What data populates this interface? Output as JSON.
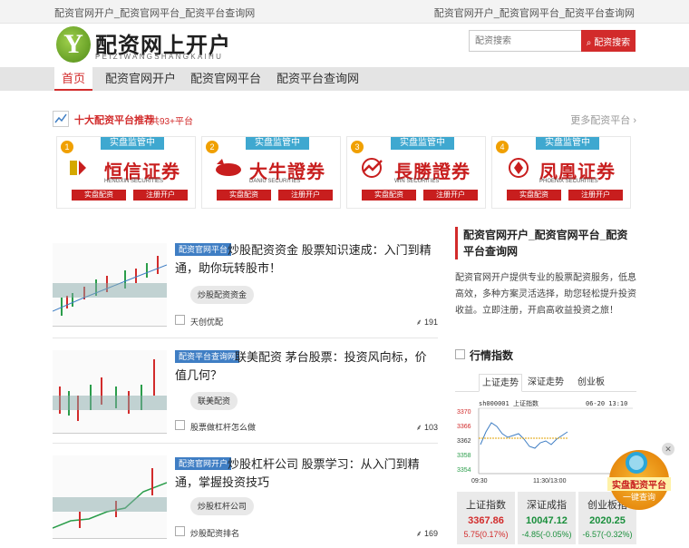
{
  "topbar": {
    "left": "配资官网开户_配资官网平台_配资平台查询网",
    "right": "配资官网开户_配资官网平台_配资平台查询网"
  },
  "header": {
    "logo_letter": "Y",
    "title": "配资网上开户",
    "subtitle": "PEIZIWANGSHANGKAIHU",
    "search_placeholder": "配资搜索",
    "search_button": "配资搜索"
  },
  "nav": [
    {
      "label": "首页"
    },
    {
      "label": "配资官网开户"
    },
    {
      "label": "配资官网平台"
    },
    {
      "label": "配资平台查询网"
    }
  ],
  "recommend": {
    "title": "十大配资平台推荐",
    "count": "共93+平台",
    "more": "更多配资平台"
  },
  "brokers": [
    {
      "rank": "1",
      "tag": "实盘监管中",
      "name": "恒信证券",
      "en": "HENGXIN SECURITIES",
      "btn1": "实盘配资",
      "btn2": "注册开户"
    },
    {
      "rank": "2",
      "tag": "实盘监管中",
      "name": "大牛證券",
      "en": "DANIU SECURITIES",
      "btn1": "实盘配资",
      "btn2": "注册开户"
    },
    {
      "rank": "3",
      "tag": "实盘监管中",
      "name": "長勝證券",
      "en": "WIN SECURITIES",
      "btn1": "实盘配资",
      "btn2": "注册开户"
    },
    {
      "rank": "4",
      "tag": "实盘监管中",
      "name": "凤凰证券",
      "en": "PHOENIX SECURITIES",
      "btn1": "实盘配资",
      "btn2": "注册开户"
    }
  ],
  "articles": [
    {
      "category": "配资官网平台",
      "title": "炒股配资资金 股票知识速成：入门到精通，助你玩转股市！",
      "tag": "炒股配资资金",
      "sub": "天创优配",
      "views": "191"
    },
    {
      "category": "配资平台查询网",
      "title": "联美配资 茅台股票：投资风向标，价值几何？",
      "tag": "联美配资",
      "sub": "股票做杠杆怎么做",
      "views": "103"
    },
    {
      "category": "配资官网开户",
      "title": "炒股杠杆公司 股票学习：从入门到精通，掌握投资技巧",
      "tag": "炒股杠杆公司",
      "sub": "炒股配资排名",
      "views": "169"
    }
  ],
  "side": {
    "title": "配资官网开户_配资官网平台_配资平台查询网",
    "desc": "配资官网开户提供专业的股票配资服务，低息高效，多种方案灵活选择，助您轻松提升投资收益。立即注册，开启高收益投资之旅！"
  },
  "market": {
    "title": "行情指数",
    "tabs": [
      {
        "label": "上证走势"
      },
      {
        "label": "深证走势"
      },
      {
        "label": "创业板"
      }
    ],
    "chart": {
      "code": "sh000001",
      "name": "上证指数",
      "time": "06-20 13:10",
      "y_ticks": [
        "3370",
        "3366",
        "3362",
        "3358",
        "3354"
      ],
      "x_ticks": [
        "09:30",
        "11:30/13:00"
      ]
    },
    "indices": [
      {
        "name": "上证指数",
        "value": "3367.86",
        "change": "5.75(0.17%)",
        "color": "#d22b2b"
      },
      {
        "name": "深证成指",
        "value": "10047.12",
        "change": "-4.85(-0.05%)",
        "color": "#1a8f3c"
      },
      {
        "name": "创业板指",
        "value": "2020.25",
        "change": "-6.57(-0.32%)",
        "color": "#1a8f3c"
      }
    ]
  },
  "float": {
    "close": "✕",
    "line1": "实盘配资平台",
    "line2": "一键查询"
  }
}
